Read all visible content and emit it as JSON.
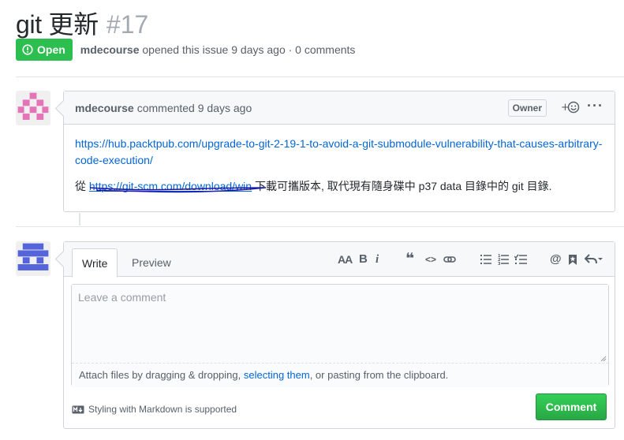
{
  "issue": {
    "title": "git 更新",
    "number": "#17",
    "state": "Open",
    "author": "mdecourse",
    "meta": "opened this issue 9 days ago · 0 comments"
  },
  "comment": {
    "author": "mdecourse",
    "when": "commented 9 days ago",
    "role": "Owner",
    "react": "+☺",
    "more": "···",
    "link1": "https://hub.packtpub.com/upgrade-to-git-2-19-1-to-avoid-a-git-submodule-vulnerability-that-causes-arbitrary-code-execution/",
    "p2_prefix": "從",
    "link2": "https://git-scm.com/download/win",
    "p2_suffix": "下載可攜版本, 取代現有隨身碟中 p37 data 目錄中的 git 目錄."
  },
  "editor": {
    "tab_write": "Write",
    "tab_preview": "Preview",
    "placeholder": "Leave a comment",
    "attach_prefix": "Attach files by dragging & dropping,",
    "attach_link": "selecting them",
    "attach_suffix": ", or pasting from the clipboard.",
    "markdown_note": "Styling with Markdown is supported",
    "submit_label": "Comment",
    "tools": {
      "header": "AA",
      "bold": "B",
      "italic": "i",
      "quote": "❝",
      "code": "<>",
      "link": "⊃⊂"
    }
  },
  "colors": {
    "open_green": "#2cbe4e",
    "link_blue": "#0366d6",
    "avatar1": "#e573b8",
    "avatar2": "#5664dc"
  }
}
